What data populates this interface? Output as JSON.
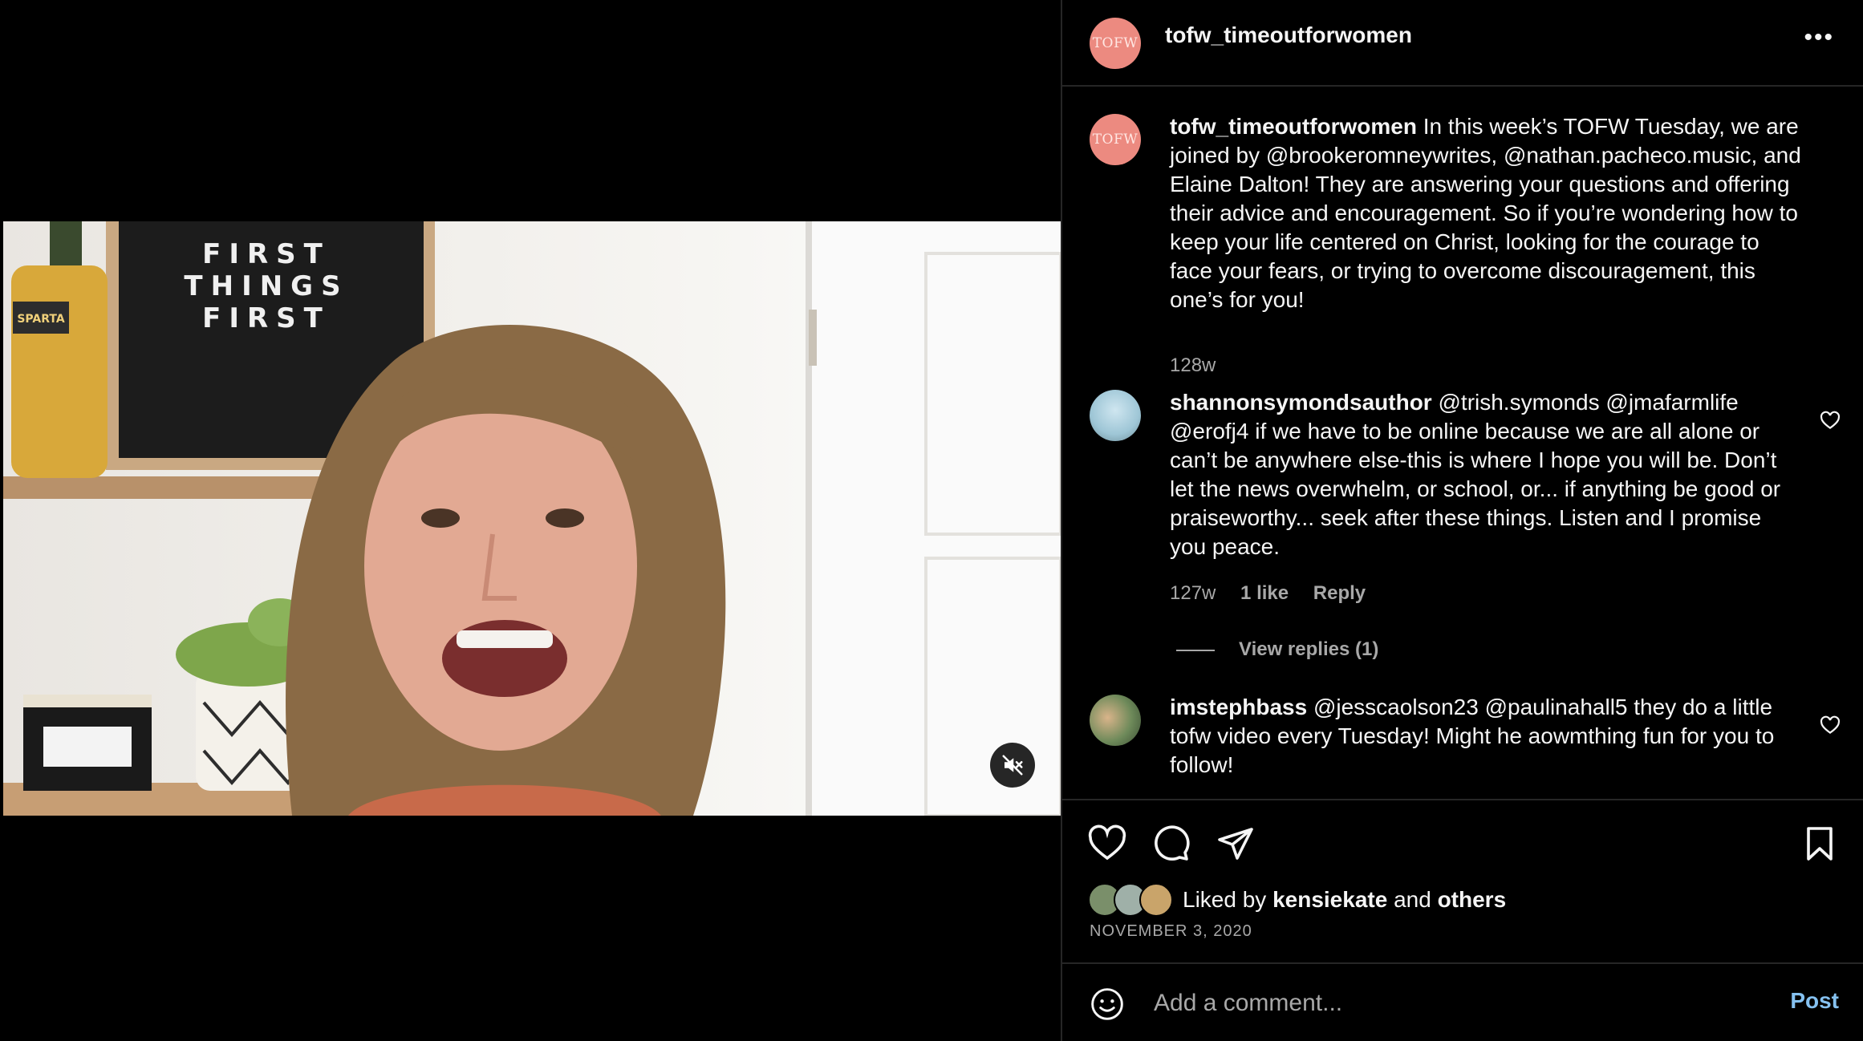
{
  "media": {
    "sign_lines": [
      "FIRST",
      "THINGS",
      "FIRST"
    ],
    "bottle_label": "SPARTA",
    "mute_icon": "speaker-muted-icon"
  },
  "post": {
    "username": "tofw_timeoutforwomen",
    "avatar_text": "TOFW",
    "caption": "In this week’s TOFW Tuesday, we are joined by @brookeromneywrites, @nathan.pacheco.music, and Elaine Dalton! They are answering your questions and offering their advice and encouragement. So if you’re wondering how to keep your life centered on Christ, looking for the courage to face your fears, or trying to overcome discouragement, this one’s for you!",
    "caption_age": "128w"
  },
  "comments": [
    {
      "username": "shannonsymondsauthor",
      "text": "@trish.symonds @jmafarmlife @erofj4 if we have to be online because we are all alone or can’t be anywhere else-this is where I hope you will be. Don’t let the news overwhelm, or school, or... if anything be good or praiseworthy... seek after these things. Listen and I promise you peace.",
      "age": "127w",
      "likes": "1 like",
      "reply": "Reply",
      "view_replies": "View replies (1)"
    },
    {
      "username": "imstephbass",
      "text": "@jesscaolson23 @paulinahall5 they do a little tofw video every Tuesday! Might he aowmthing fun for you to follow!"
    }
  ],
  "likes": {
    "prefix": "Liked by",
    "user": "kensiekate",
    "and": "and",
    "others": "others"
  },
  "date": "NOVEMBER 3, 2020",
  "add_comment": {
    "placeholder": "Add a comment...",
    "post_label": "Post"
  },
  "colors": {
    "accent": "#85c1f0",
    "avatar": "#ec8a80",
    "muted_text": "#a8a8a8"
  }
}
